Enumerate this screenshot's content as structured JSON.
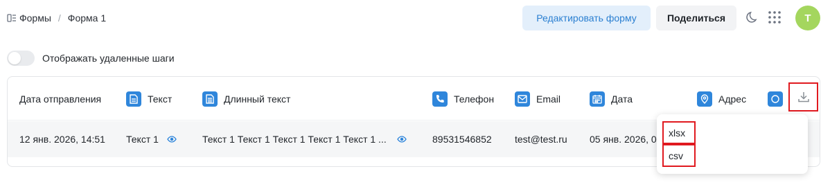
{
  "breadcrumb": {
    "root": "Формы",
    "current": "Форма 1"
  },
  "header": {
    "edit_label": "Редактировать форму",
    "share_label": "Поделиться",
    "avatar_initial": "T"
  },
  "toggle": {
    "label": "Отображать удаленные шаги",
    "enabled": false
  },
  "table": {
    "columns": [
      "Дата отправления",
      "Текст",
      "Длинный текст",
      "Телефон",
      "Email",
      "Дата",
      "Адрес"
    ],
    "row": {
      "submitted": "12 янв. 2026, 14:51",
      "text": "Текст 1",
      "long_text": "Текст 1 Текст 1 Текст 1 Текст 1 Текст 1 ...",
      "phone": "89531546852",
      "email": "test@test.ru",
      "date": "05 янв. 2026, 0"
    }
  },
  "download_menu": {
    "items": [
      "xlsx",
      "csv"
    ]
  },
  "colors": {
    "accent": "#2f86db",
    "highlight": "#e0191f",
    "avatar": "#a4d65e"
  }
}
